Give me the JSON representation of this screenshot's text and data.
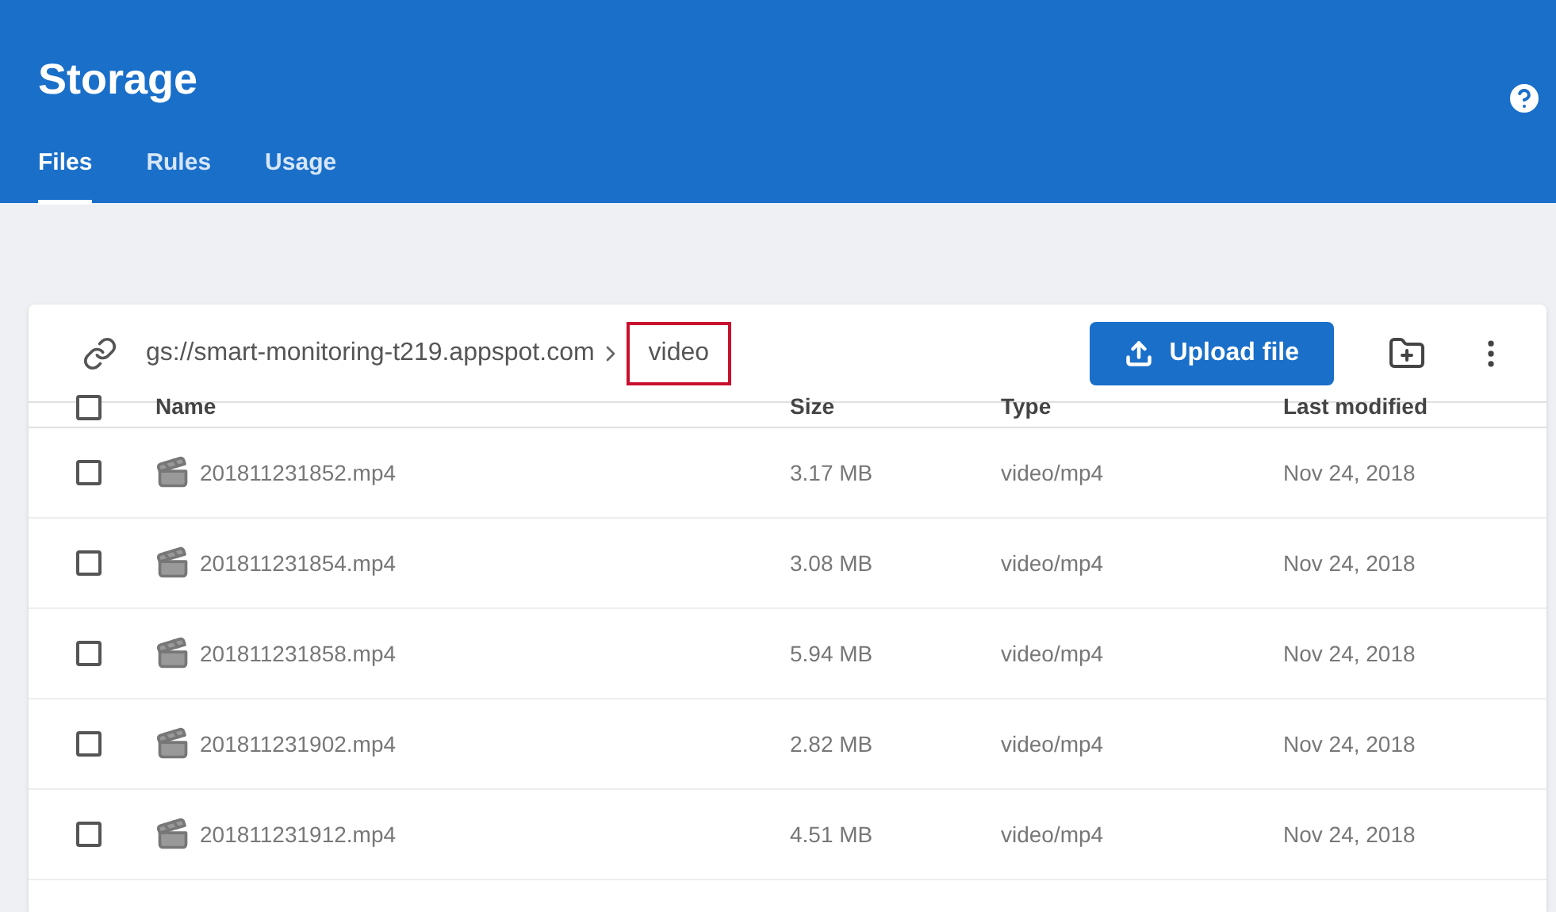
{
  "header": {
    "title": "Storage",
    "tabs": [
      {
        "label": "Files",
        "selected": true
      },
      {
        "label": "Rules",
        "selected": false
      },
      {
        "label": "Usage",
        "selected": false
      }
    ]
  },
  "toolbar": {
    "breadcrumbs": [
      {
        "label": "gs://smart-monitoring-t219.appspot.com",
        "highlighted": false
      },
      {
        "label": "video",
        "highlighted": true
      }
    ],
    "upload_button": "Upload file"
  },
  "table": {
    "columns": [
      "Name",
      "Size",
      "Type",
      "Last modified"
    ],
    "all_checked": false,
    "rows": [
      {
        "name": "201811231852.mp4",
        "size": "3.17 MB",
        "type": "video/mp4",
        "modified": "Nov 24, 2018",
        "checked": false
      },
      {
        "name": "201811231854.mp4",
        "size": "3.08 MB",
        "type": "video/mp4",
        "modified": "Nov 24, 2018",
        "checked": false
      },
      {
        "name": "201811231858.mp4",
        "size": "5.94 MB",
        "type": "video/mp4",
        "modified": "Nov 24, 2018",
        "checked": false
      },
      {
        "name": "201811231902.mp4",
        "size": "2.82 MB",
        "type": "video/mp4",
        "modified": "Nov 24, 2018",
        "checked": false
      },
      {
        "name": "201811231912.mp4",
        "size": "4.51 MB",
        "type": "video/mp4",
        "modified": "Nov 24, 2018",
        "checked": false
      }
    ]
  }
}
